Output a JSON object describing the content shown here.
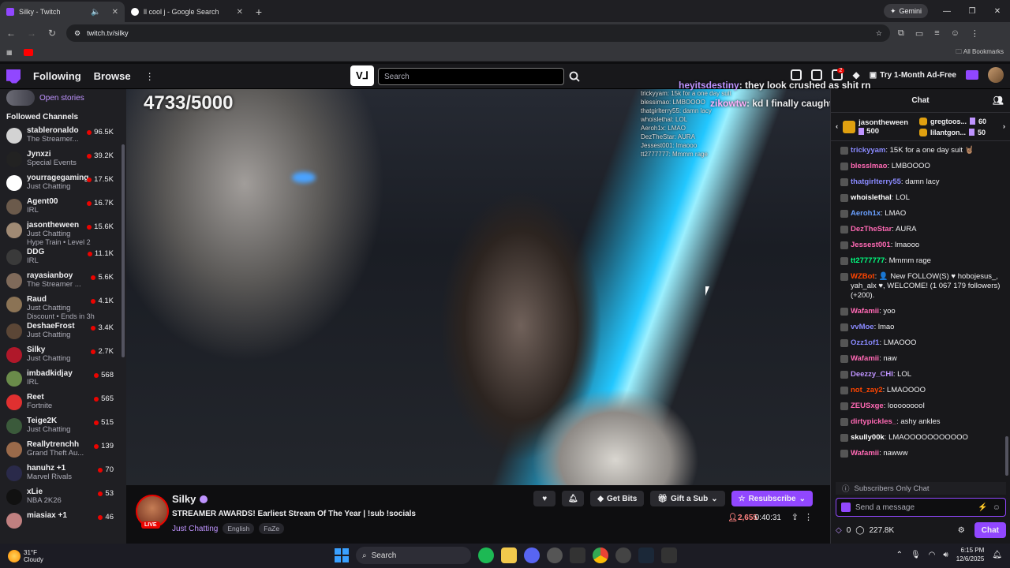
{
  "browser": {
    "tabs": [
      {
        "title": "Silky - Twitch",
        "active": true
      },
      {
        "title": "ll cool j - Google Search",
        "active": false
      }
    ],
    "gemini_label": "Gemini",
    "url": "twitch.tv/silky",
    "all_bookmarks": "All Bookmarks"
  },
  "twitch_nav": {
    "following": "Following",
    "browse": "Browse",
    "search_placeholder": "Search",
    "notif_count": "2",
    "ad_free": "Try 1-Month Ad-Free"
  },
  "sidebar": {
    "open_stories": "Open stories",
    "heading": "Followed Channels",
    "channels": [
      {
        "name": "stableronaldo",
        "category": "The Streamer...",
        "viewers": "96.5K",
        "color": "#d3d3d3"
      },
      {
        "name": "Jynxzi",
        "category": "Special Events",
        "viewers": "39.2K",
        "color": "#222222"
      },
      {
        "name": "yourragegaming",
        "category": "Just Chatting",
        "viewers": "17.5K",
        "color": "#ffffff"
      },
      {
        "name": "Agent00",
        "category": "IRL",
        "viewers": "16.7K",
        "color": "#6b5a4b"
      },
      {
        "name": "jasontheween",
        "category": "Just Chatting",
        "extra": "Hype Train • Level 2",
        "viewers": "15.6K",
        "color": "#a08a74"
      },
      {
        "name": "DDG",
        "category": "IRL",
        "viewers": "11.1K",
        "color": "#3a3a3a"
      },
      {
        "name": "rayasianboy",
        "category": "The Streamer ...",
        "viewers": "5.6K",
        "color": "#7f6a5a"
      },
      {
        "name": "Raud",
        "category": "Just Chatting",
        "extra": "Discount • Ends in 3h",
        "viewers": "4.1K",
        "color": "#8b7355"
      },
      {
        "name": "DeshaeFrost",
        "category": "Just Chatting",
        "viewers": "3.4K",
        "color": "#5b4636"
      },
      {
        "name": "Silky",
        "category": "Just Chatting",
        "viewers": "2.7K",
        "color": "#b0182a"
      },
      {
        "name": "imbadkidjay",
        "category": "IRL",
        "viewers": "568",
        "color": "#6a8b4a"
      },
      {
        "name": "Reet",
        "category": "Fortnite",
        "viewers": "565",
        "color": "#e03030"
      },
      {
        "name": "Teige2K",
        "category": "Just Chatting",
        "viewers": "515",
        "color": "#3b5a3b"
      },
      {
        "name": "Reallytrenchh",
        "category": "Grand Theft Au...",
        "viewers": "139",
        "color": "#9a6a4a"
      },
      {
        "name": "hanuhz +1",
        "category": "Marvel Rivals",
        "viewers": "70",
        "color": "#2a2a4a"
      },
      {
        "name": "xLie",
        "category": "NBA 2K26",
        "viewers": "53",
        "color": "#111111"
      },
      {
        "name": "miasiax +1",
        "category": "",
        "viewers": "46",
        "color": "#c08080"
      }
    ]
  },
  "video": {
    "overlay_counter": "4733/5000",
    "overlay_chat": [
      "trickyyam: 15k for a one day suit",
      "blessimao: LMBOOOO",
      "thatgirlterry55: damn lacy",
      "whoislethal: LOL",
      "Aeroh1x: LMAO",
      "DezTheStar: AURA",
      "Jessest001: lmaooo",
      "tt2777777: Mmmm rage"
    ],
    "floating": [
      {
        "user": "heyitsdestiny",
        "text": ": they look crushed as shit rn"
      },
      {
        "user": "zikowtw",
        "text": ": kd I finally caught up wit stranger things"
      }
    ]
  },
  "stream_info": {
    "streamer": "Silky",
    "live": "LIVE",
    "title": "STREAMER AWARDS! Earliest Stream Of The Year | !sub !socials",
    "category": "Just Chatting",
    "tags": [
      "English",
      "FaZe"
    ],
    "get_bits": "Get Bits",
    "gift_sub": "Gift a Sub",
    "resubscribe": "Resubscribe",
    "viewers": "2,655",
    "uptime": "0:40:31"
  },
  "chat": {
    "header": "Chat",
    "gift_leader": {
      "name": "jasontheween",
      "count": "500"
    },
    "gift_others": [
      {
        "name": "gregtoos...",
        "count": "60"
      },
      {
        "name": "lilantgon...",
        "count": "50"
      }
    ],
    "messages": [
      {
        "user": "trickyyam",
        "color": "#8a8aff",
        "text": ": 15K for a one day suit 🤘🏽"
      },
      {
        "user": "blesslmao",
        "color": "#ff69b4",
        "text": ": LMBOOOO"
      },
      {
        "user": "thatgirlterry55",
        "color": "#8a8aff",
        "text": ": damn lacy"
      },
      {
        "user": "whoislethal",
        "color": "#ffffff",
        "text": ": LOL"
      },
      {
        "user": "Aeroh1x",
        "color": "#6aa0ff",
        "text": ": LMAO"
      },
      {
        "user": "DezTheStar",
        "color": "#ff69b4",
        "text": ": AURA"
      },
      {
        "user": "Jessest001",
        "color": "#ff69b4",
        "text": ": lmaooo"
      },
      {
        "user": "tt2777777",
        "color": "#00ff7f",
        "text": ": Mmmm rage"
      },
      {
        "user": "WZBot",
        "color": "#ff4500",
        "text": ": 👤 New FOLLOW(S) ♥ hobojesus_, yah_alx ♥, WELCOME! (1 067 179 followers) (+200)."
      },
      {
        "user": "Wafamii",
        "color": "#ff69b4",
        "text": ": yoo"
      },
      {
        "user": "vvMoe",
        "color": "#8a8aff",
        "text": ": lmao"
      },
      {
        "user": "Ozz1of1",
        "color": "#8a8aff",
        "text": ": LMAOOO"
      },
      {
        "user": "Wafamii",
        "color": "#ff69b4",
        "text": ": naw"
      },
      {
        "user": "Deezzy_CHI",
        "color": "#bf94ff",
        "text": ": LOL"
      },
      {
        "user": "not_zay2",
        "color": "#ff4500",
        "text": ": LMAOOOO"
      },
      {
        "user": "ZEUSxge",
        "color": "#ff69b4",
        "text": ": looooooooI"
      },
      {
        "user": "dirtypickles_",
        "color": "#ff69b4",
        "text": ": ashy ankles"
      },
      {
        "user": "skully00k",
        "color": "#ffffff",
        "text": ": LMAOOOOOOOOOOO"
      },
      {
        "user": "Wafamii",
        "color": "#ff69b4",
        "text": ": nawww"
      }
    ],
    "subs_only": "Subscribers Only Chat",
    "input_placeholder": "Send a message",
    "bits": "0",
    "points": "227.8K",
    "send": "Chat"
  },
  "taskbar": {
    "temp": "31°F",
    "weather": "Cloudy",
    "search": "Search",
    "time": "6:15 PM",
    "date": "12/6/2025"
  }
}
